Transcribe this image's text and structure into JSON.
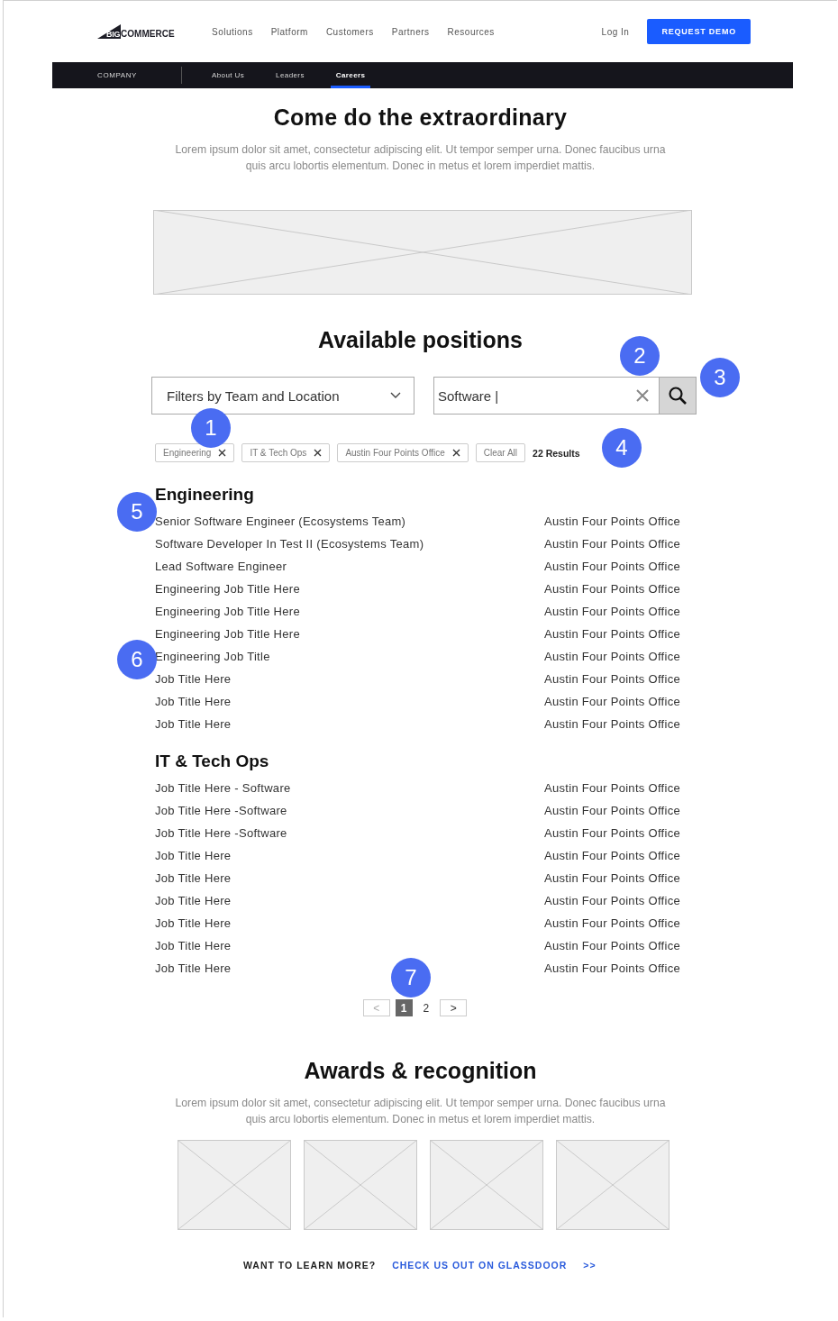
{
  "header": {
    "logo": {
      "prefix": "BIG",
      "rest": "COMMERCE"
    },
    "nav": [
      "Solutions",
      "Platform",
      "Customers",
      "Partners",
      "Resources"
    ],
    "login": "Log In",
    "cta": "REQUEST DEMO"
  },
  "subnav": {
    "section": "COMPANY",
    "tabs": [
      {
        "label": "About Us",
        "selected": false
      },
      {
        "label": "Leaders",
        "selected": false
      },
      {
        "label": "Careers",
        "selected": true
      }
    ]
  },
  "hero": {
    "title": "Come do the extraordinary",
    "text": "Lorem ipsum dolor sit amet, consectetur adipiscing elit. Ut tempor semper urna. Donec faucibus urna quis arcu lobortis elementum. Donec in metus et lorem imperdiet mattis."
  },
  "positions": {
    "title": "Available positions",
    "filter": {
      "placeholder": "Filters by Team and Location"
    },
    "search": {
      "value": "Software |"
    },
    "chips": [
      "Engineering",
      "IT & Tech Ops",
      "Austin Four Points Office"
    ],
    "clear_all": "Clear All",
    "results": "22 Results",
    "groups": [
      {
        "name": "Engineering",
        "jobs": [
          {
            "title": "Senior Software Engineer (Ecosystems Team)",
            "location": "Austin Four Points Office"
          },
          {
            "title": "Software Developer In Test II (Ecosystems Team)",
            "location": "Austin Four Points Office"
          },
          {
            "title": "Lead Software Engineer",
            "location": "Austin Four Points Office"
          },
          {
            "title": "Engineering Job Title Here",
            "location": "Austin Four Points Office"
          },
          {
            "title": "Engineering Job Title Here",
            "location": "Austin Four Points Office"
          },
          {
            "title": "Engineering Job Title Here",
            "location": "Austin Four Points Office"
          },
          {
            "title": "Engineering Job Title",
            "location": "Austin Four Points Office"
          },
          {
            "title": "Job Title Here",
            "location": "Austin Four Points Office"
          },
          {
            "title": "Job Title Here",
            "location": "Austin Four Points Office"
          },
          {
            "title": "Job Title Here",
            "location": "Austin Four Points Office"
          }
        ]
      },
      {
        "name": "IT & Tech Ops",
        "jobs": [
          {
            "title": "Job Title Here - Software",
            "location": "Austin Four Points Office"
          },
          {
            "title": "Job Title Here -Software",
            "location": "Austin Four Points Office"
          },
          {
            "title": "Job Title Here -Software",
            "location": "Austin Four Points Office"
          },
          {
            "title": "Job Title Here",
            "location": "Austin Four Points Office"
          },
          {
            "title": "Job Title Here",
            "location": "Austin Four Points Office"
          },
          {
            "title": "Job Title Here",
            "location": "Austin Four Points Office"
          },
          {
            "title": "Job Title Here",
            "location": "Austin Four Points Office"
          },
          {
            "title": "Job Title Here",
            "location": "Austin Four Points Office"
          },
          {
            "title": "Job Title Here",
            "location": "Austin Four Points Office"
          }
        ]
      }
    ],
    "pagination": {
      "prev": "<",
      "next": ">",
      "pages": [
        {
          "label": "1",
          "selected": true
        },
        {
          "label": "2",
          "selected": false
        }
      ]
    }
  },
  "awards": {
    "title": "Awards & recognition",
    "text": "Lorem ipsum dolor sit amet, consectetur adipiscing elit. Ut tempor semper urna. Donec faucibus urna quis arcu lobortis elementum. Donec in metus et lorem imperdiet mattis."
  },
  "footer": {
    "question": "WANT TO LEARN MORE?",
    "link": "CHECK US OUT ON GLASSDOOR",
    "arrow": ">>"
  },
  "annotations": [
    "1",
    "2",
    "3",
    "4",
    "5",
    "6",
    "7"
  ]
}
